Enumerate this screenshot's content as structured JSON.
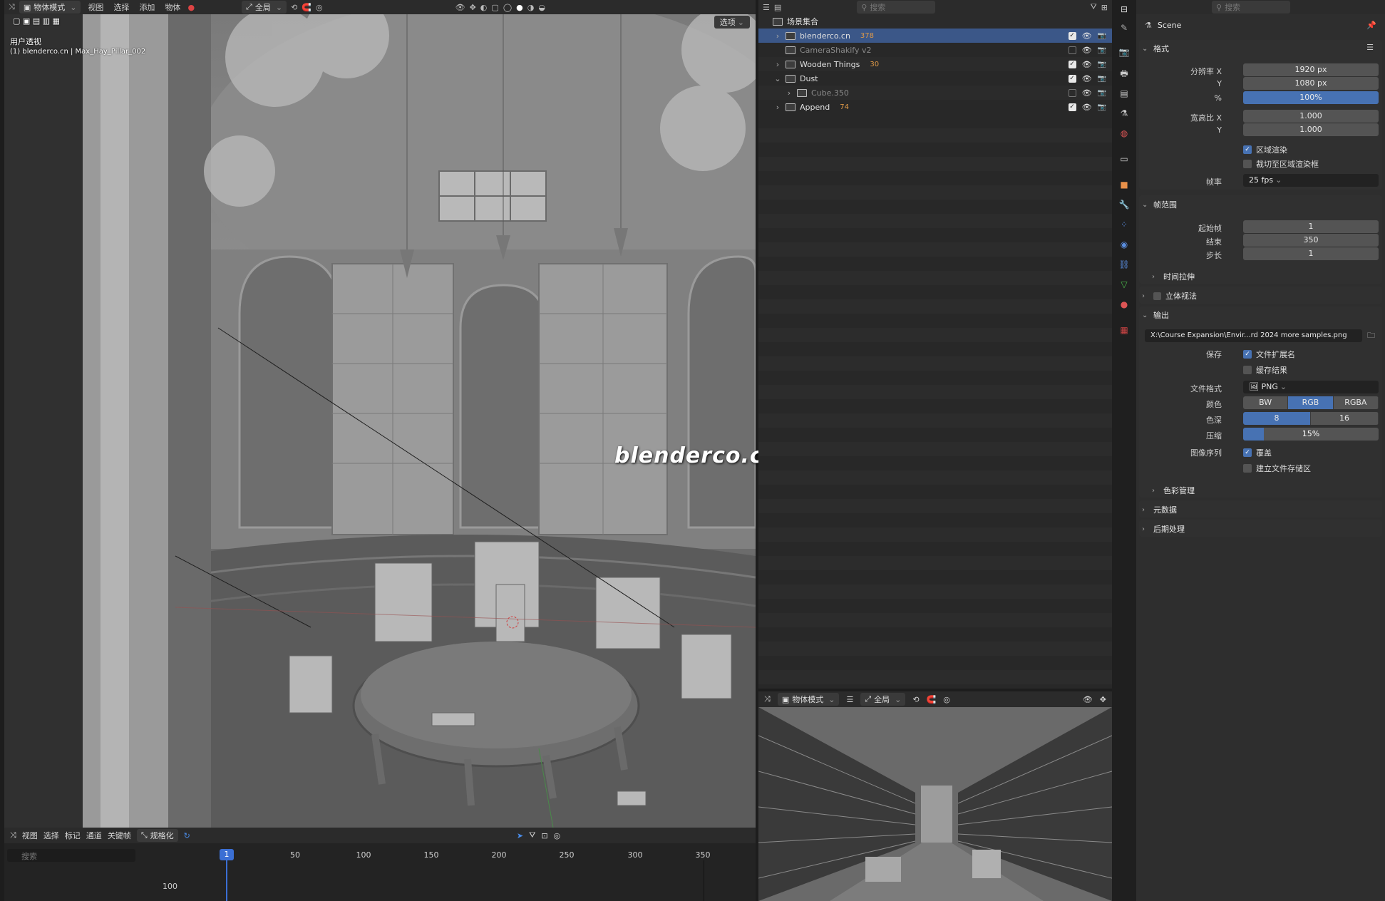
{
  "viewport": {
    "toolbar": {
      "mode": "物体模式",
      "menu": [
        "视图",
        "选择",
        "添加",
        "物体"
      ],
      "transform_space": "全局",
      "options": "选项"
    },
    "overlay_title": "用户透视",
    "overlay_subtitle": "(1) blenderco.cn | Max_Hay_Pillar_002",
    "watermark": "blenderco.cn"
  },
  "timeline": {
    "menu": [
      "视图",
      "选择",
      "标记",
      "通道",
      "关键帧"
    ],
    "normalize": "规格化",
    "search_placeholder": "搜索",
    "current_frame": "1",
    "ticks": [
      "50",
      "100",
      "150",
      "200",
      "250",
      "300",
      "350"
    ],
    "row_value": "100"
  },
  "outliner": {
    "search_placeholder": "搜索",
    "root": "场景集合",
    "items": [
      {
        "name": "blenderco.cn",
        "selected": true,
        "extra": "378",
        "checked": true,
        "dim": false,
        "expander": "›"
      },
      {
        "name": "CameraShakify v2",
        "selected": false,
        "extra": "",
        "checked": false,
        "dim": true,
        "expander": ""
      },
      {
        "name": "Wooden Things",
        "selected": false,
        "extra": "30",
        "checked": true,
        "dim": false,
        "expander": "›"
      },
      {
        "name": "Dust",
        "selected": false,
        "extra": "",
        "checked": true,
        "dim": false,
        "expander": "⌄"
      },
      {
        "name": "Cube.350",
        "selected": false,
        "extra": "",
        "checked": false,
        "dim": true,
        "expander": "›"
      },
      {
        "name": "Append",
        "selected": false,
        "extra": "74",
        "checked": true,
        "dim": false,
        "expander": "›"
      }
    ]
  },
  "camera_view": {
    "mode": "物体模式",
    "transform_space": "全局"
  },
  "properties": {
    "search_placeholder": "搜索",
    "scene": "Scene",
    "format": {
      "title": "格式",
      "res_x_label": "分辨率 X",
      "res_x": "1920 px",
      "res_y_label": "Y",
      "res_y": "1080 px",
      "pct_label": "%",
      "pct": "100%",
      "aspect_x_label": "宽高比 X",
      "aspect_x": "1.000",
      "aspect_y_label": "Y",
      "aspect_y": "1.000",
      "region_render": "区域渲染",
      "crop_region": "裁切至区域渲染框",
      "fps_label": "帧率",
      "fps": "25 fps"
    },
    "frame_range": {
      "title": "帧范围",
      "start_label": "起始帧",
      "start": "1",
      "end_label": "结束",
      "end": "350",
      "step_label": "步长",
      "step": "1",
      "time_stretch": "时间拉伸"
    },
    "stereoscopy": "立体视法",
    "output": {
      "title": "输出",
      "path": "X:\\Course Expansion\\Envir...rd 2024 more samples.png",
      "save_label": "保存",
      "file_ext": "文件扩展名",
      "cache_result": "缓存结果",
      "file_format_label": "文件格式",
      "file_format": "PNG",
      "color_label": "颜色",
      "color_modes": [
        "BW",
        "RGB",
        "RGBA"
      ],
      "color_selected": "RGB",
      "depth_label": "色深",
      "depth_modes": [
        "8",
        "16"
      ],
      "depth_selected": "8",
      "compression_label": "压缩",
      "compression": "15%",
      "compression_value": 0.15,
      "image_seq_label": "图像序列",
      "overwrite": "覆盖",
      "placeholders": "建立文件存储区",
      "color_management": "色彩管理"
    },
    "metadata": "元数据",
    "post_processing": "后期处理"
  }
}
